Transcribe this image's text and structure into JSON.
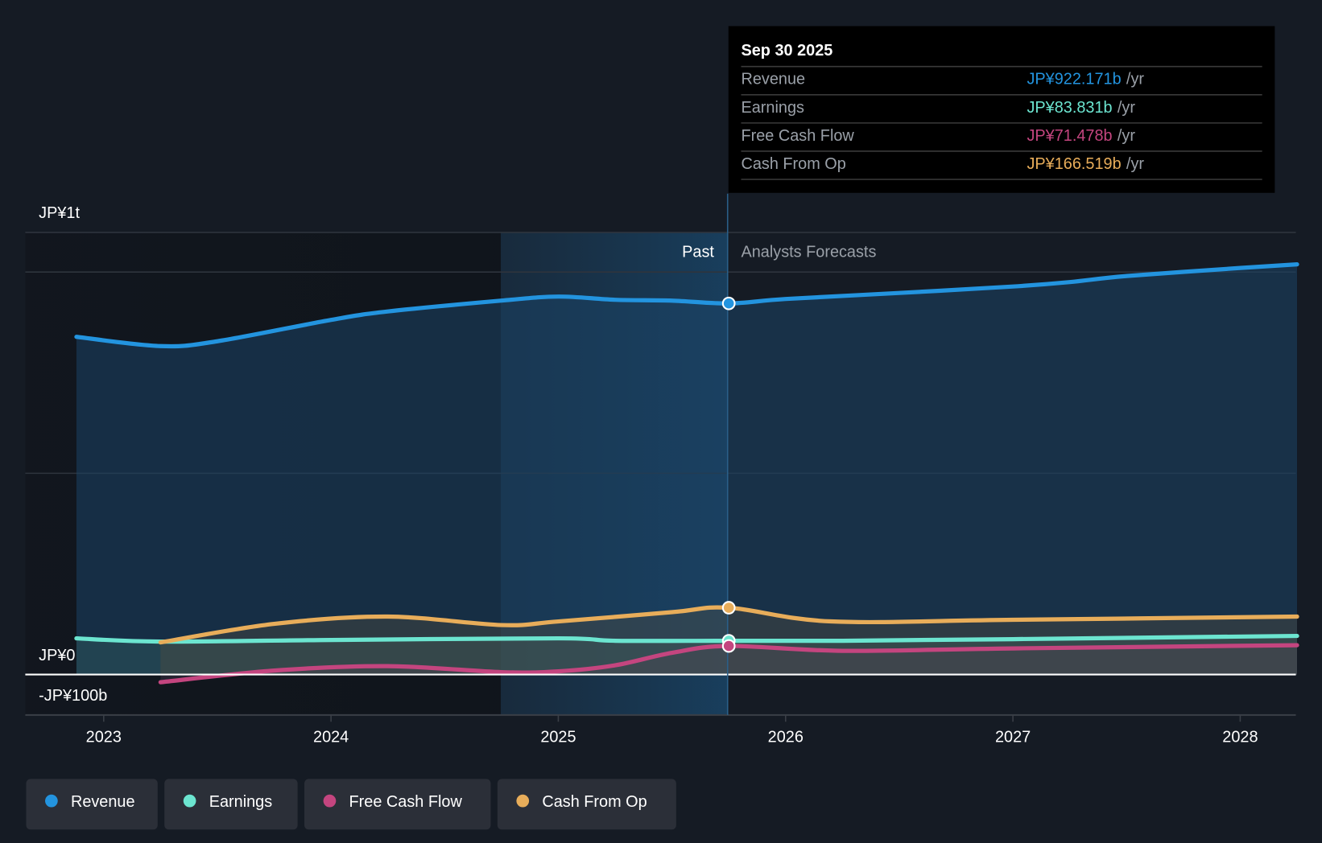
{
  "chart_data": {
    "type": "line",
    "y_axis": {
      "ticks": [
        {
          "value": 1000,
          "label": "JP¥1t"
        },
        {
          "value": 0,
          "label": "JP¥0"
        },
        {
          "value": -100,
          "label": "-JP¥100b"
        }
      ],
      "ylim": [
        -100,
        1100
      ],
      "unit": "JP¥ billions"
    },
    "x_axis": {
      "ticks": [
        2023,
        2024,
        2025,
        2026,
        2027,
        2028
      ],
      "tick_labels": [
        "2023",
        "2024",
        "2025",
        "2026",
        "2027",
        "2028"
      ],
      "xlim": [
        2022.7,
        2028.25
      ]
    },
    "divider_x": 2025.75,
    "past_highlight_start": 2024.75,
    "regions": {
      "past": "Past",
      "forecast": "Analysts Forecasts"
    },
    "series": [
      {
        "name": "Revenue",
        "color": "#2394df",
        "x": [
          2022.88,
          2023.25,
          2023.5,
          2024,
          2024.25,
          2024.75,
          2025,
          2025.25,
          2025.5,
          2025.75,
          2026,
          2026.5,
          2027,
          2027.25,
          2027.5,
          2028,
          2028.25
        ],
        "values": [
          839,
          816,
          828,
          881,
          902,
          929,
          939,
          931,
          929,
          922,
          933,
          948,
          964,
          975,
          990,
          1010,
          1019
        ]
      },
      {
        "name": "Earnings",
        "color": "#6ce5d0",
        "x": [
          2022.88,
          2023.25,
          2024,
          2025,
          2025.25,
          2025.75,
          2026.25,
          2027,
          2028.25
        ],
        "values": [
          90,
          82,
          86,
          90,
          84,
          84,
          84,
          88,
          96
        ]
      },
      {
        "name": "Free Cash Flow",
        "color": "#c4457f",
        "x": [
          2023.25,
          2023.75,
          2024.25,
          2024.75,
          2025,
          2025.25,
          2025.5,
          2025.75,
          2026.25,
          2027,
          2028.25
        ],
        "values": [
          -19,
          10,
          21,
          6,
          8,
          23,
          54,
          71,
          59,
          65,
          73
        ]
      },
      {
        "name": "Cash From Op",
        "color": "#e8ad5a",
        "x": [
          2023.25,
          2023.75,
          2024.25,
          2024.75,
          2025,
          2025.5,
          2025.75,
          2026.2,
          2027,
          2028.25
        ],
        "values": [
          80,
          126,
          144,
          123,
          132,
          155,
          166,
          132,
          136,
          144
        ]
      }
    ],
    "legend": "bottom-left"
  },
  "tooltip": {
    "date": "Sep 30 2025",
    "rows": [
      {
        "label": "Revenue",
        "value": "JP¥922.171b",
        "suffix": "/yr",
        "color": "#2394df"
      },
      {
        "label": "Earnings",
        "value": "JP¥83.831b",
        "suffix": "/yr",
        "color": "#6ce5d0"
      },
      {
        "label": "Free Cash Flow",
        "value": "JP¥71.478b",
        "suffix": "/yr",
        "color": "#c4457f"
      },
      {
        "label": "Cash From Op",
        "value": "JP¥166.519b",
        "suffix": "/yr",
        "color": "#e8ad5a"
      }
    ]
  }
}
